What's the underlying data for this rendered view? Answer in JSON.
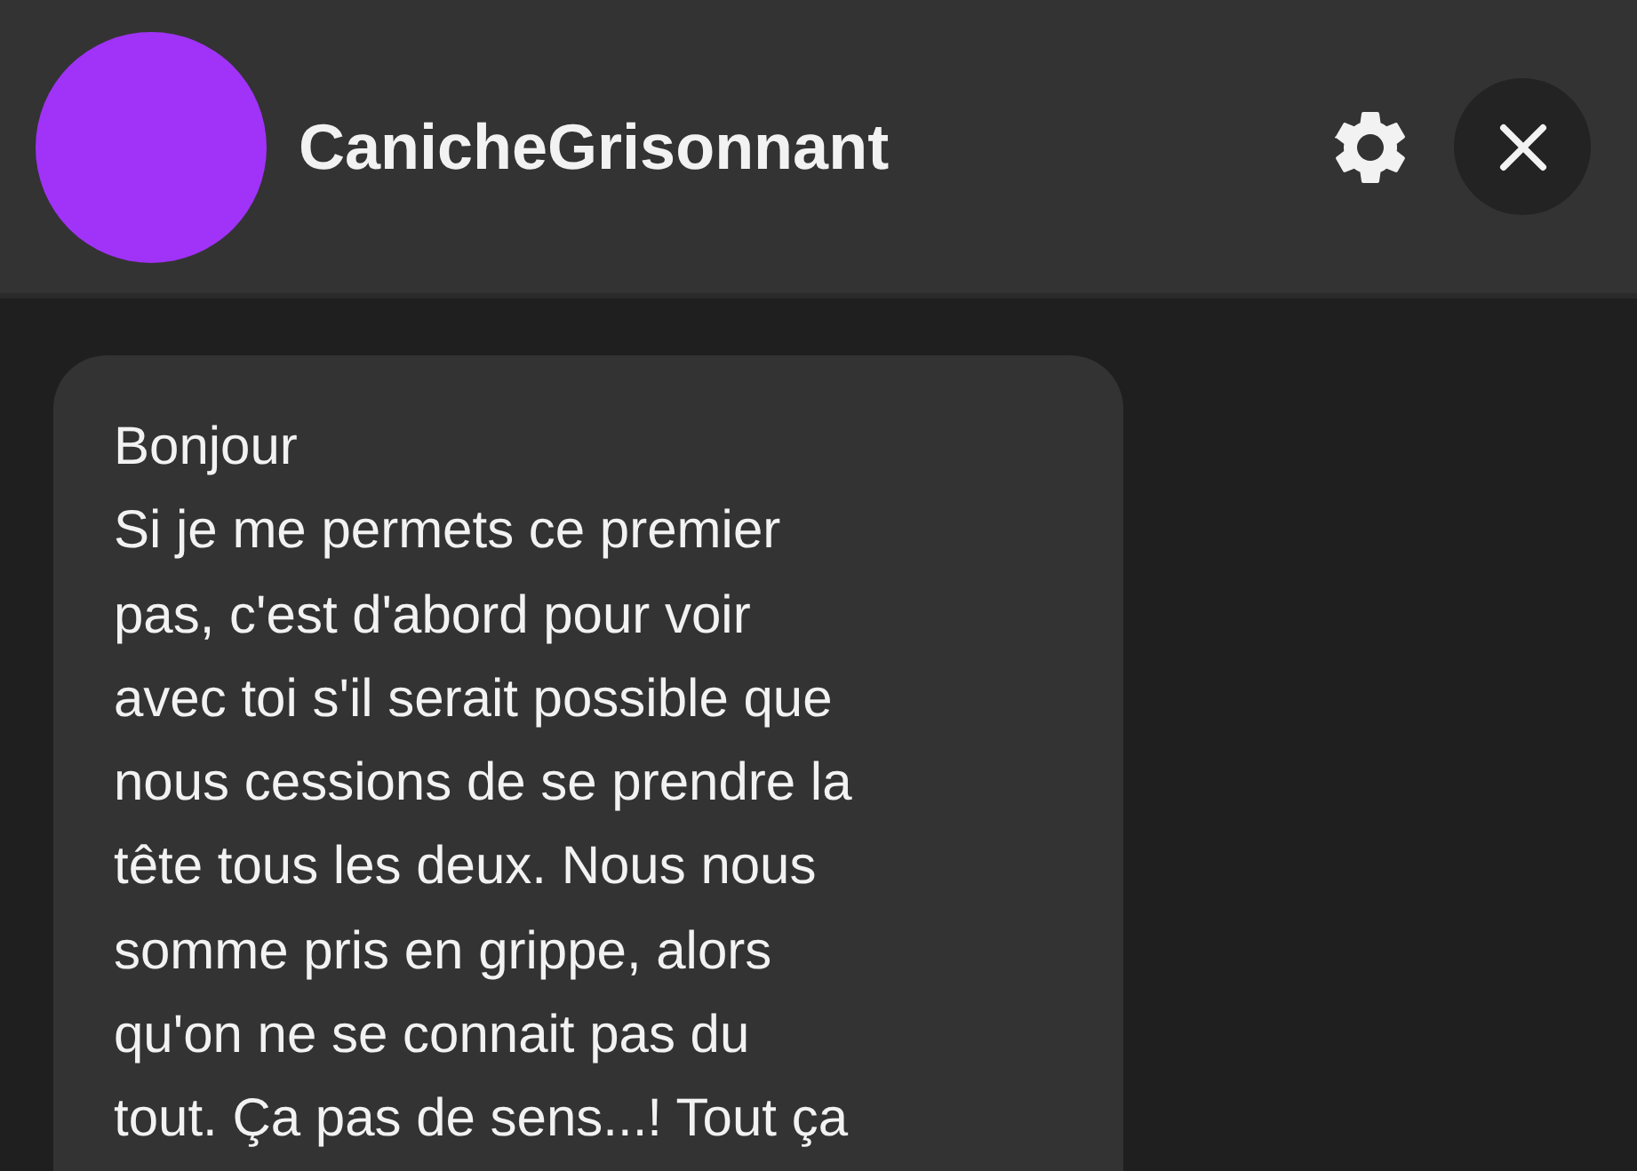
{
  "header": {
    "username": "CanicheGrisonnant"
  },
  "messages": [
    {
      "text": "Bonjour\nSi je me permets ce premier\npas, c'est d'abord pour voir\navec toi s'il serait possible que\nnous cessions de se prendre la\ntête tous les deux. Nous nous\nsomme pris en grippe, alors\nqu'on ne se connait pas du\ntout. Ça pas de sens...! Tout ça"
    }
  ]
}
